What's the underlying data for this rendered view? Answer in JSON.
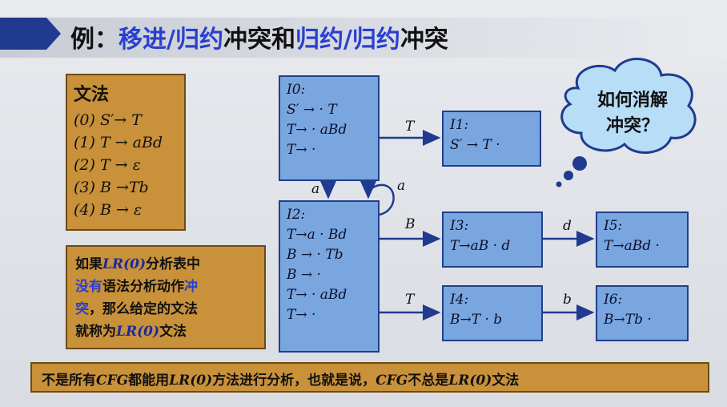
{
  "title": {
    "prefix": "例：",
    "part1": "移进/归约",
    "part2": "冲突和",
    "part3": "归约/归约",
    "part4": "冲突"
  },
  "grammar": {
    "heading": "文法",
    "rules": [
      "(0) S′→ T",
      "(1) T → aBd",
      "(2) T → ε",
      "(3) B →Tb",
      "(4) B → ε"
    ]
  },
  "note": {
    "t1": "如果",
    "t2": "LR(0)",
    "t3": "分析表中",
    "t4": "没有",
    "t5": "语法分析动作",
    "t6": "冲",
    "t7": "突",
    "t8": "，那么给定的文法",
    "t9": "就称为",
    "t10": "LR(0)",
    "t11": "文法"
  },
  "bottom": {
    "t1": "不是所有",
    "t2": "CFG",
    "t3": "都能用",
    "t4": "LR(0)",
    "t5": "方法进行分析，也就是说，",
    "t6": "CFG",
    "t7": "不总是",
    "t8": "LR(0)",
    "t9": "文法"
  },
  "states": {
    "I0": {
      "label": "I0:",
      "items": [
        "S′ → · T",
        "T→ · aBd",
        "T→ ·"
      ]
    },
    "I1": {
      "label": "I1:",
      "items": [
        "S′ → T ·"
      ]
    },
    "I2": {
      "label": "I2:",
      "items": [
        "T→a · Bd",
        "B → · Tb",
        "B → ·",
        "T→ · aBd",
        "T→ ·"
      ]
    },
    "I3": {
      "label": "I3:",
      "items": [
        "T→aB · d"
      ]
    },
    "I4": {
      "label": "I4:",
      "items": [
        "B→T · b"
      ]
    },
    "I5": {
      "label": "I5:",
      "items": [
        "T→aBd ·"
      ]
    },
    "I6": {
      "label": "I6:",
      "items": [
        "B→Tb ·"
      ]
    }
  },
  "transitions": {
    "I0_I1": "T",
    "I0_I2": "a",
    "I2_self": "a",
    "I2_I3": "B",
    "I2_I4": "T",
    "I3_I5": "d",
    "I4_I6": "b"
  },
  "cloud": {
    "line1": "如何消解",
    "line2": "冲突？"
  },
  "colors": {
    "state_fill": "#7aa6e0",
    "box_fill": "#c9913a",
    "title_blue": "#2a3fd0",
    "arrow_blue": "#1f3a8f"
  }
}
